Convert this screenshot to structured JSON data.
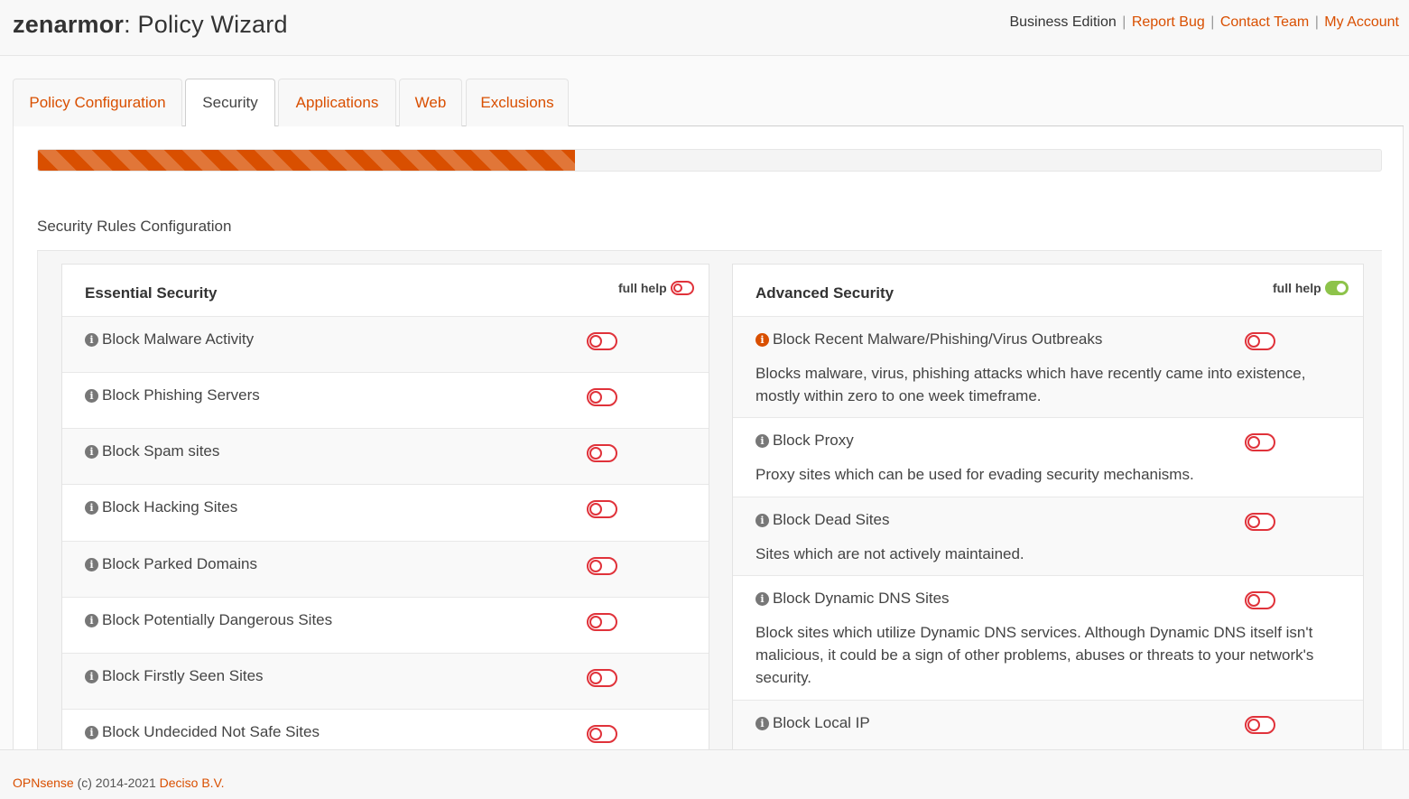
{
  "header": {
    "brand": "zenarmor",
    "title_suffix": ": Policy Wizard",
    "edition": "Business Edition",
    "links": {
      "report_bug": "Report Bug",
      "contact_team": "Contact Team",
      "my_account": "My Account"
    },
    "separator": "|"
  },
  "tabs": [
    {
      "label": "Policy Configuration",
      "active": false
    },
    {
      "label": "Security",
      "active": true
    },
    {
      "label": "Applications",
      "active": false
    },
    {
      "label": "Web",
      "active": false
    },
    {
      "label": "Exclusions",
      "active": false
    }
  ],
  "progress": {
    "percent": 40
  },
  "section_title": "Security Rules Configuration",
  "essential": {
    "title": "Essential Security",
    "full_help_label": "full help",
    "full_help_on": false,
    "rules": [
      {
        "label": "Block Malware Activity",
        "enabled": false
      },
      {
        "label": "Block Phishing Servers",
        "enabled": false
      },
      {
        "label": "Block Spam sites",
        "enabled": false
      },
      {
        "label": "Block Hacking Sites",
        "enabled": false
      },
      {
        "label": "Block Parked Domains",
        "enabled": false
      },
      {
        "label": "Block Potentially Dangerous Sites",
        "enabled": false
      },
      {
        "label": "Block Firstly Seen Sites",
        "enabled": false
      },
      {
        "label": "Block Undecided Not Safe Sites",
        "enabled": false
      }
    ]
  },
  "advanced": {
    "title": "Advanced Security",
    "full_help_label": "full help",
    "full_help_on": true,
    "rules": [
      {
        "label": "Block Recent Malware/Phishing/Virus Outbreaks",
        "enabled": false,
        "description": "Blocks malware, virus, phishing attacks which have recently came into existence, mostly within zero to one week timeframe."
      },
      {
        "label": "Block Proxy",
        "enabled": false,
        "description": "Proxy sites which can be used for evading security mechanisms."
      },
      {
        "label": "Block Dead Sites",
        "enabled": false,
        "description": "Sites which are not actively maintained."
      },
      {
        "label": "Block Dynamic DNS Sites",
        "enabled": false,
        "description": "Block sites which utilize Dynamic DNS services. Although Dynamic DNS itself isn't malicious, it could be a sign of other problems, abuses or threats to your network's security."
      },
      {
        "label": "Block Local IP",
        "enabled": false,
        "description": ""
      }
    ]
  },
  "footer": {
    "opnsense": "OPNsense",
    "copyright": " (c) 2014-2021 ",
    "company": "Deciso B.V."
  },
  "colors": {
    "accent": "#d94f00",
    "toggle_off": "#e0323a",
    "toggle_on": "#8dc34a"
  }
}
